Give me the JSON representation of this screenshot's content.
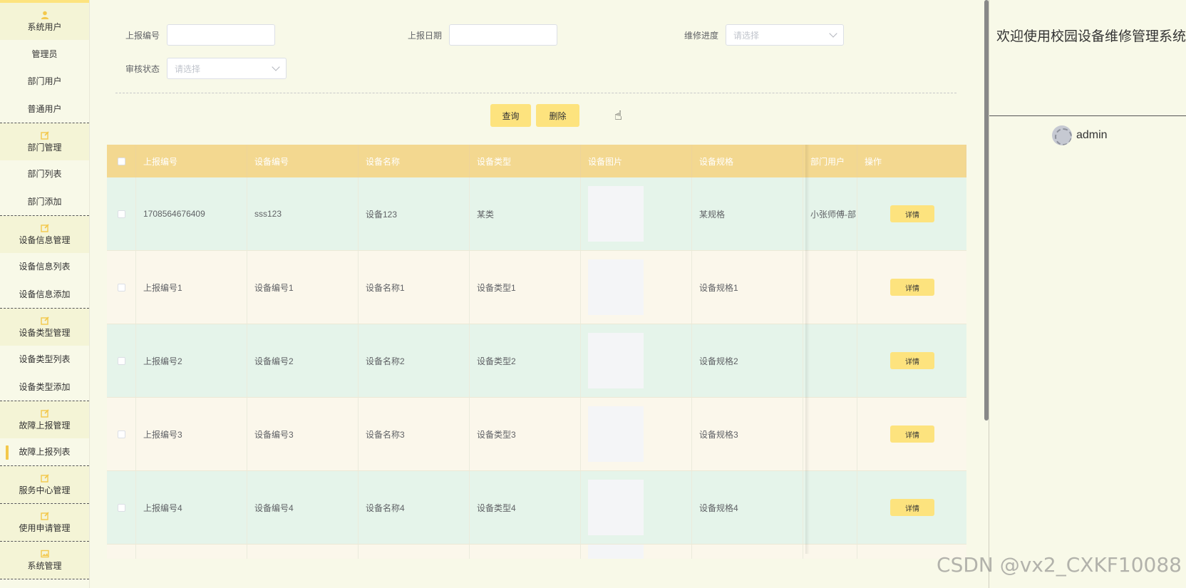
{
  "sidebar": {
    "groups": [
      {
        "title": "系统用户",
        "icon": "user-icon",
        "items": [
          "管理员",
          "部门用户",
          "普通用户"
        ]
      },
      {
        "title": "部门管理",
        "icon": "edit-icon",
        "items": [
          "部门列表",
          "部门添加"
        ]
      },
      {
        "title": "设备信息管理",
        "icon": "edit-icon",
        "items": [
          "设备信息列表",
          "设备信息添加"
        ]
      },
      {
        "title": "设备类型管理",
        "icon": "edit-icon",
        "items": [
          "设备类型列表",
          "设备类型添加"
        ]
      },
      {
        "title": "故障上报管理",
        "icon": "edit-icon",
        "items": [
          "故障上报列表"
        ],
        "active": "故障上报列表"
      },
      {
        "title": "服务中心管理",
        "icon": "edit-icon",
        "items": []
      },
      {
        "title": "使用申请管理",
        "icon": "edit-icon",
        "items": []
      },
      {
        "title": "系统管理",
        "icon": "image-icon",
        "items": []
      }
    ]
  },
  "filters": {
    "report_no_label": "上报编号",
    "report_date_label": "上报日期",
    "progress_label": "维修进度",
    "progress_placeholder": "请选择",
    "audit_label": "审核状态",
    "audit_placeholder": "请选择"
  },
  "actions": {
    "query": "查询",
    "delete": "删除"
  },
  "table": {
    "headers": [
      "上报编号",
      "设备编号",
      "设备名称",
      "设备类型",
      "设备图片",
      "设备规格",
      "部门用户",
      "操作"
    ],
    "rows": [
      {
        "report_no": "1708564676409",
        "device_no": "sss123",
        "device_name": "设备123",
        "device_type": "某类",
        "spec": "某规格",
        "dept_user": "小张师傅-部门",
        "action": "详情"
      },
      {
        "report_no": "上报编号1",
        "device_no": "设备编号1",
        "device_name": "设备名称1",
        "device_type": "设备类型1",
        "spec": "设备规格1",
        "dept_user": "",
        "action": "详情"
      },
      {
        "report_no": "上报编号2",
        "device_no": "设备编号2",
        "device_name": "设备名称2",
        "device_type": "设备类型2",
        "spec": "设备规格2",
        "dept_user": "",
        "action": "详情"
      },
      {
        "report_no": "上报编号3",
        "device_no": "设备编号3",
        "device_name": "设备名称3",
        "device_type": "设备类型3",
        "spec": "设备规格3",
        "dept_user": "",
        "action": "详情"
      },
      {
        "report_no": "上报编号4",
        "device_no": "设备编号4",
        "device_name": "设备名称4",
        "device_type": "设备类型4",
        "spec": "设备规格4",
        "dept_user": "",
        "action": "详情"
      }
    ]
  },
  "right": {
    "welcome": "欢迎使用校园设备维修管理系统",
    "username": "admin"
  },
  "watermark": "CSDN @vx2_CXKF10088",
  "colors": {
    "accent": "#fde37e",
    "header": "#f3d890",
    "row_even": "#e5f4ea",
    "row_odd": "#fbf7eb"
  }
}
